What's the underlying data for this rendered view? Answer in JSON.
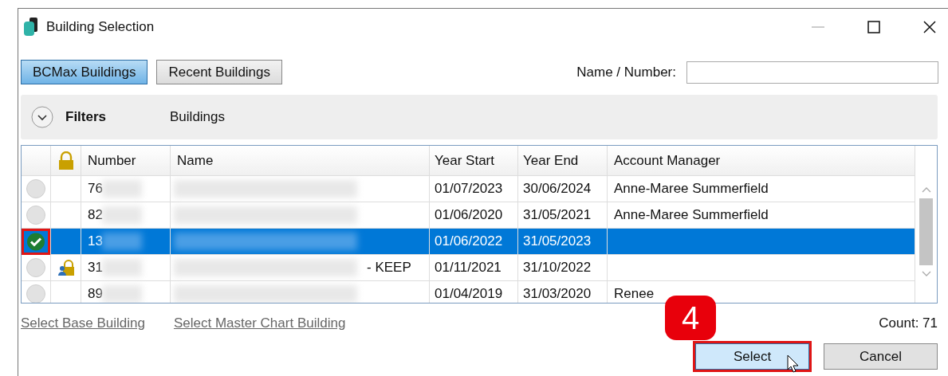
{
  "window": {
    "title": "Building Selection"
  },
  "tabs": [
    {
      "label": "BCMax Buildings",
      "selected": true
    },
    {
      "label": "Recent Buildings",
      "selected": false
    }
  ],
  "search": {
    "label": "Name / Number:"
  },
  "filters": {
    "label": "Filters",
    "expanded": false,
    "section": "Buildings"
  },
  "table": {
    "columns": [
      "Number",
      "Name",
      "Year Start",
      "Year End",
      "Account Manager"
    ],
    "rows": [
      {
        "number": "76",
        "name": "",
        "year_start": "01/07/2023",
        "year_end": "30/06/2024",
        "manager": "Anne-Maree Summerfield",
        "selected": false,
        "locked": false
      },
      {
        "number": "82",
        "name": "",
        "year_start": "01/06/2020",
        "year_end": "31/05/2021",
        "manager": "Anne-Maree Summerfield",
        "selected": false,
        "locked": false
      },
      {
        "number": "13",
        "name": "",
        "year_start": "01/06/2022",
        "year_end": "31/05/2023",
        "manager": "",
        "selected": true,
        "locked": false
      },
      {
        "number": "31",
        "name": "- KEEP",
        "year_start": "01/11/2021",
        "year_end": "31/10/2022",
        "manager": "",
        "selected": false,
        "locked": true
      },
      {
        "number": "89",
        "name": "",
        "year_start": "01/04/2019",
        "year_end": "31/03/2020",
        "manager": "Renee",
        "selected": false,
        "locked": false
      }
    ]
  },
  "links": [
    "Select Base Building",
    "Select Master Chart Building"
  ],
  "count": "Count: 71",
  "step_badge": "4",
  "buttons": [
    {
      "label": "Select",
      "highlighted": true
    },
    {
      "label": "Cancel",
      "highlighted": false
    }
  ]
}
